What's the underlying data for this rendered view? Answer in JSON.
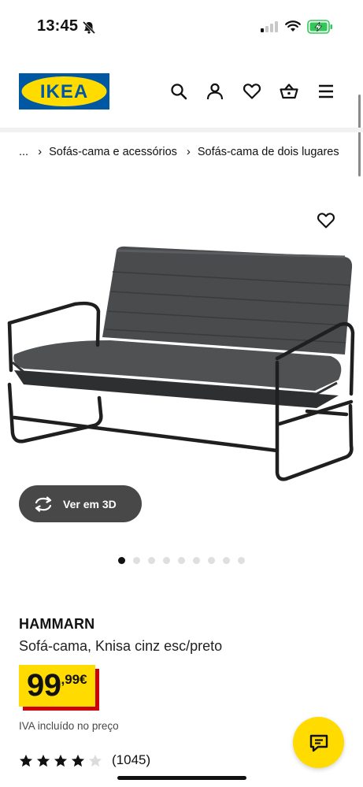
{
  "status_bar": {
    "time": "13:45",
    "battery_color": "#32c759"
  },
  "header": {
    "logo_text": "IKEA",
    "logo_colors": {
      "blue": "#0058a3",
      "yellow": "#ffdb00"
    },
    "icons": [
      "search-icon",
      "account-icon",
      "wishlist-icon",
      "cart-icon",
      "menu-icon"
    ]
  },
  "breadcrumb": {
    "items": [
      "...",
      "Sofás-cama e acessórios",
      "Sofás-cama de dois lugares"
    ],
    "separator": "›"
  },
  "gallery": {
    "view3d_label": "Ver em 3D",
    "slide_count": 9,
    "active_slide": 1
  },
  "product": {
    "name": "HAMMARN",
    "description": "Sofá-cama, Knisa cinz esc/preto",
    "price_integer": "99",
    "price_decimal": ",99€",
    "tax_note": "IVA incluído no preço",
    "rating": 4,
    "rating_max": 5,
    "review_count": "(1045)",
    "price_colors": {
      "background": "#ffdb00",
      "shadow": "#cc0008"
    }
  }
}
